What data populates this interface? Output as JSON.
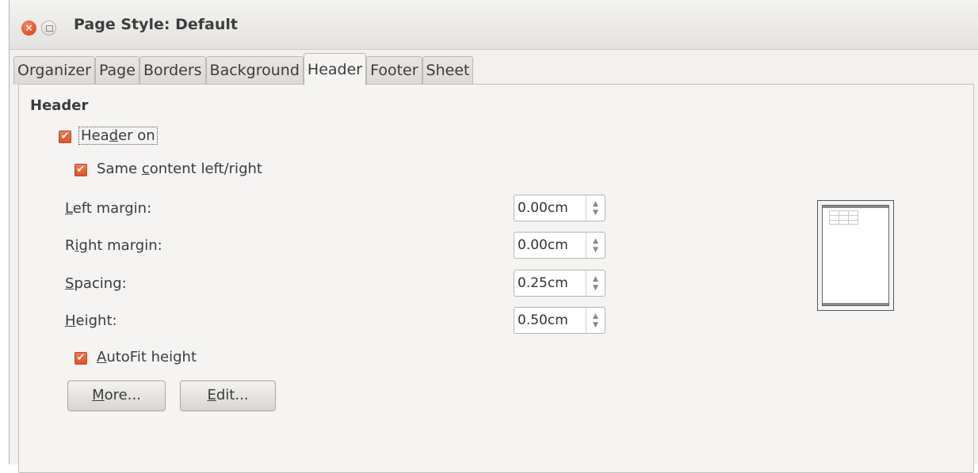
{
  "window": {
    "title": "Page Style: Default",
    "close_glyph": "×"
  },
  "tabs": [
    {
      "label": "Organizer"
    },
    {
      "label": "Page"
    },
    {
      "label": "Borders"
    },
    {
      "label": "Background"
    },
    {
      "label": "Header",
      "active": true
    },
    {
      "label": "Footer"
    },
    {
      "label": "Sheet"
    }
  ],
  "header_section": {
    "title": "Header",
    "header_on": {
      "prefix": "Hea",
      "accel": "d",
      "suffix": "er on",
      "checked": true
    },
    "same_content": {
      "prefix": "Same ",
      "accel": "c",
      "suffix": "ontent left/right",
      "checked": true
    },
    "left_margin": {
      "prefix": "",
      "accel": "L",
      "suffix": "eft margin:",
      "value": "0.00cm"
    },
    "right_margin": {
      "prefix": "R",
      "accel": "i",
      "suffix": "ght margin:",
      "value": "0.00cm"
    },
    "spacing": {
      "prefix": "",
      "accel": "S",
      "suffix": "pacing:",
      "value": "0.25cm"
    },
    "height": {
      "prefix": "",
      "accel": "H",
      "suffix": "eight:",
      "value": "0.50cm"
    },
    "autofit": {
      "prefix": "",
      "accel": "A",
      "suffix": "utoFit height",
      "checked": true
    },
    "more_button": {
      "prefix": "",
      "accel": "M",
      "suffix": "ore..."
    },
    "edit_button": {
      "prefix": "",
      "accel": "E",
      "suffix": "dit..."
    }
  },
  "colors": {
    "accent": "#dd5426",
    "window_bg": "#f2f1f0"
  },
  "icons": {
    "check": "✔",
    "spin_up": "▲",
    "spin_down": "▼"
  }
}
